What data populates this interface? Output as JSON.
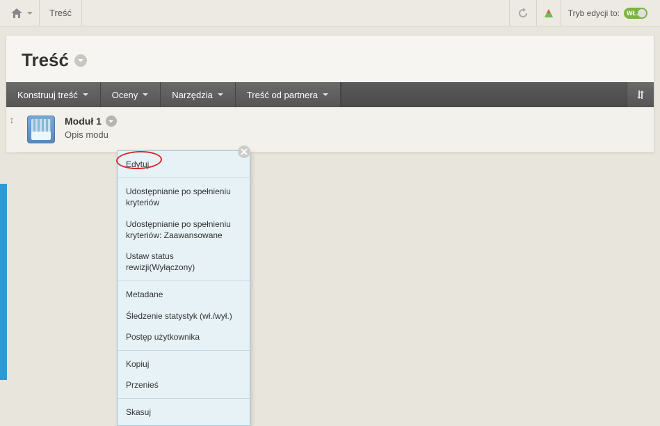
{
  "topbar": {
    "breadcrumb": "Treść",
    "edit_mode_label": "Tryb edycji to:",
    "toggle_text": "WŁ."
  },
  "page": {
    "title": "Treść"
  },
  "navbar": {
    "items": [
      {
        "label": "Konstruuj treść"
      },
      {
        "label": "Oceny"
      },
      {
        "label": "Narzędzia"
      },
      {
        "label": "Treść od partnera"
      }
    ]
  },
  "module": {
    "title": "Moduł 1",
    "description": "Opis modu"
  },
  "menu": {
    "groups": [
      [
        "Edytuj"
      ],
      [
        "Udostępnianie po spełnieniu kryteriów",
        "Udostępnianie po spełnieniu kryteriów: Zaawansowane",
        "Ustaw status rewizji(Wyłączony)"
      ],
      [
        "Metadane",
        "Śledzenie statystyk (wł./wył.)",
        "Postęp użytkownika"
      ],
      [
        "Kopiuj",
        "Przenieś"
      ],
      [
        "Skasuj"
      ]
    ]
  }
}
